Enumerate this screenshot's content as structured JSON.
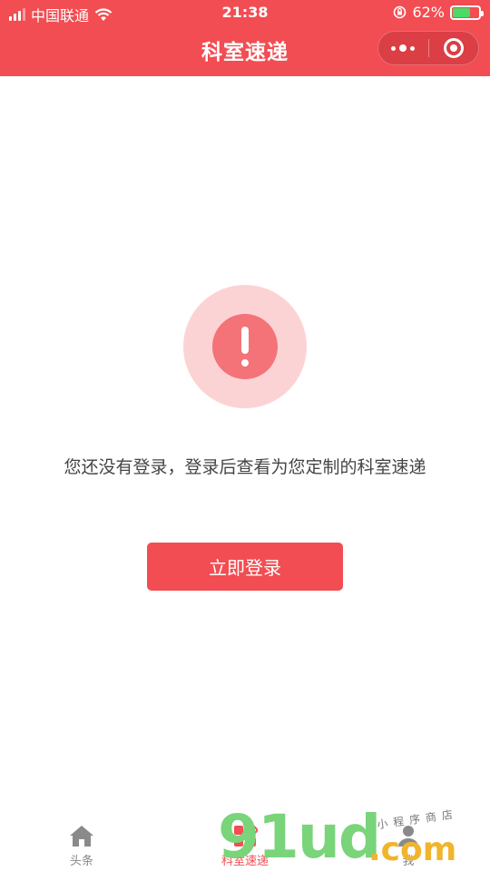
{
  "status_bar": {
    "carrier": "中国联通",
    "time": "21:38",
    "battery_percent": "62%",
    "battery_level": 0.62
  },
  "navbar": {
    "title": "科室速递"
  },
  "main": {
    "icon": "exclamation-alert-icon",
    "message": "您还没有登录，登录后查看为您定制的科室速递",
    "login_button": "立即登录"
  },
  "tabbar": {
    "tabs": [
      {
        "label": "头条",
        "icon": "home-icon",
        "active": false
      },
      {
        "label": "科室速递",
        "icon": "grid-icon",
        "active": true
      },
      {
        "label": "我",
        "icon": "user-icon",
        "active": false
      }
    ]
  },
  "watermark": {
    "digits": "91ud",
    "domain": ".com",
    "subtitle": "小程序商店"
  },
  "colors": {
    "brand": "#f24d52",
    "alert_outer": "#fcd3d5",
    "alert_inner": "#f37378",
    "battery": "#4cd964"
  }
}
